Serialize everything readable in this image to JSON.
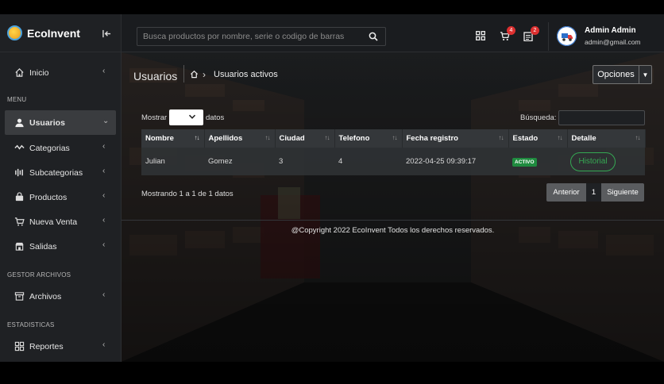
{
  "brand": {
    "name": "EcoInvent"
  },
  "sidebar": {
    "items_top": [
      {
        "label": "Inicio",
        "icon": "home-icon"
      }
    ],
    "section_menu": "MENU",
    "items_menu": [
      {
        "label": "Usuarios",
        "icon": "user-icon",
        "active": true
      },
      {
        "label": "Categorias",
        "icon": "activity-icon"
      },
      {
        "label": "Subcategorias",
        "icon": "equalizer-icon"
      },
      {
        "label": "Productos",
        "icon": "bag-icon"
      },
      {
        "label": "Nueva Venta",
        "icon": "cart-icon"
      },
      {
        "label": "Salidas",
        "icon": "store-icon"
      }
    ],
    "section_archivos": "GESTOR ARCHIVOS",
    "items_archivos": [
      {
        "label": "Archivos",
        "icon": "archive-icon"
      }
    ],
    "section_estadisticas": "ESTADISTICAS",
    "items_estadisticas": [
      {
        "label": "Reportes",
        "icon": "grid-icon"
      }
    ]
  },
  "topbar": {
    "search_placeholder": "Busca productos por nombre, serie o codigo de barras",
    "cart_badge": "4",
    "orders_badge": "2",
    "user_name": "Admin Admin",
    "user_email": "admin@gmail.com"
  },
  "page": {
    "title": "Usuarios",
    "breadcrumb_current": "Usuarios activos",
    "options_label": "Opciones"
  },
  "table": {
    "show_label": "Mostrar",
    "show_after": "datos",
    "search_label": "Búsqueda:",
    "columns": [
      "Nombre",
      "Apellidos",
      "Ciudad",
      "Telefono",
      "Fecha registro",
      "Estado",
      "Detalle"
    ],
    "rows": [
      {
        "nombre": "Julian",
        "apellidos": "Gomez",
        "ciudad": "3",
        "telefono": "4",
        "fecha": "2022-04-25 09:39:17",
        "estado": "ACTIVO",
        "detalle": "Historial"
      }
    ],
    "showing": "Mostrando 1 a 1 de 1 datos",
    "pager": {
      "prev": "Anterior",
      "page": "1",
      "next": "Siguiente"
    }
  },
  "footer": {
    "text": "@Copyright 2022 EcoInvent Todos los derechos reservados."
  },
  "colors": {
    "accent_green": "#36a853",
    "badge_red": "#dd3030",
    "active_status": "#1f8b3f"
  }
}
